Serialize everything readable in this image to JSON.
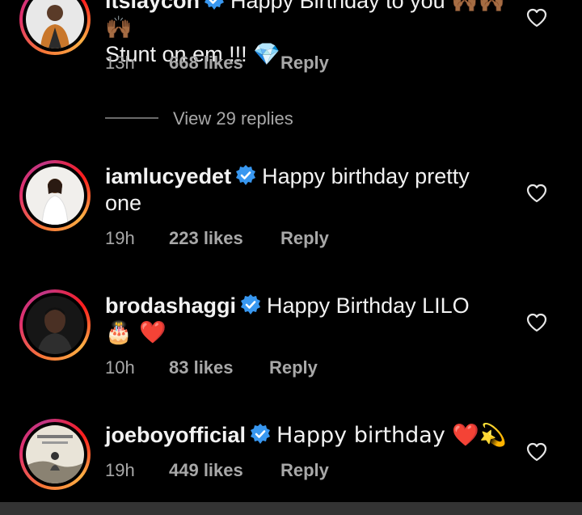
{
  "comments": [
    {
      "username": "itslaycon",
      "text": "Happy Birthday to you 🙌🏾🙌🏾🙌🏾",
      "text2": "Stunt on em !!! 💎",
      "time": "13h",
      "likes": "668 likes",
      "reply": "Reply"
    },
    {
      "username": "iamlucyedet",
      "text": "Happy birthday pretty",
      "text2": "one",
      "time": "19h",
      "likes": "223 likes",
      "reply": "Reply"
    },
    {
      "username": "brodashaggi",
      "text": "Happy Birthday LILO",
      "text2": "🎂 ❤️",
      "time": "10h",
      "likes": "83 likes",
      "reply": "Reply"
    },
    {
      "username": "joeboyofficial",
      "text": "Happy birthday ❤️💫",
      "time": "19h",
      "likes": "449 likes",
      "reply": "Reply"
    }
  ],
  "view_replies": "View 29 replies",
  "colors": {
    "background": "#000000",
    "verified": "#3897f0",
    "secondary_text": "#a8a8a8"
  }
}
